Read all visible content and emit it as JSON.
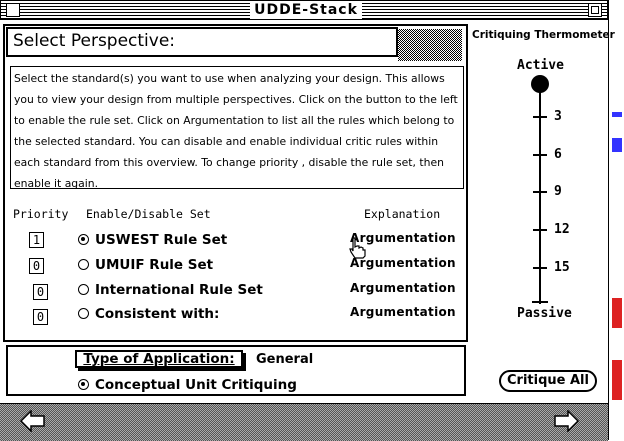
{
  "window": {
    "title": "UDDE-Stack"
  },
  "perspective": {
    "title": "Select Perspective:",
    "instructions": "Select the standard(s) you want to use when analyzing your design. This allows you to view your design from multiple perspectives.  Click on the button to the left to enable the rule set.  Click on Argumentation to list all the rules which belong to the selected standard. You can  disable and enable individual critic rules within each standard from this overview.  To change priority , disable the rule set, then enable it again."
  },
  "headers": {
    "priority": "Priority",
    "enable": "Enable/Disable Set",
    "explanation": "Explanation"
  },
  "rules": [
    {
      "priority": "1",
      "label": "USWEST Rule Set",
      "selected": true,
      "explanation": "Argumentation"
    },
    {
      "priority": "0",
      "label": "UMUIF Rule Set",
      "selected": false,
      "explanation": "Argumentation"
    },
    {
      "priority": "0",
      "label": "International Rule Set",
      "selected": false,
      "explanation": "Argumentation"
    },
    {
      "priority": "0",
      "label": "Consistent with:",
      "selected": false,
      "explanation": "Argumentation"
    }
  ],
  "application": {
    "label": "Type of Application:",
    "value": "General",
    "option": "Conceptual Unit Critiquing",
    "option_selected": true
  },
  "thermometer": {
    "title": "Critiquing Thermometer",
    "top_label": "Active",
    "bottom_label": "Passive",
    "ticks": [
      "3",
      "6",
      "9",
      "12",
      "15"
    ],
    "level": "Active"
  },
  "buttons": {
    "critique_all": "Critique All"
  },
  "icons": {
    "close": "close-box-icon",
    "zoom": "zoom-box-icon",
    "back": "left-arrow-icon",
    "forward": "right-arrow-icon",
    "cursor": "hand-pointer-icon"
  }
}
